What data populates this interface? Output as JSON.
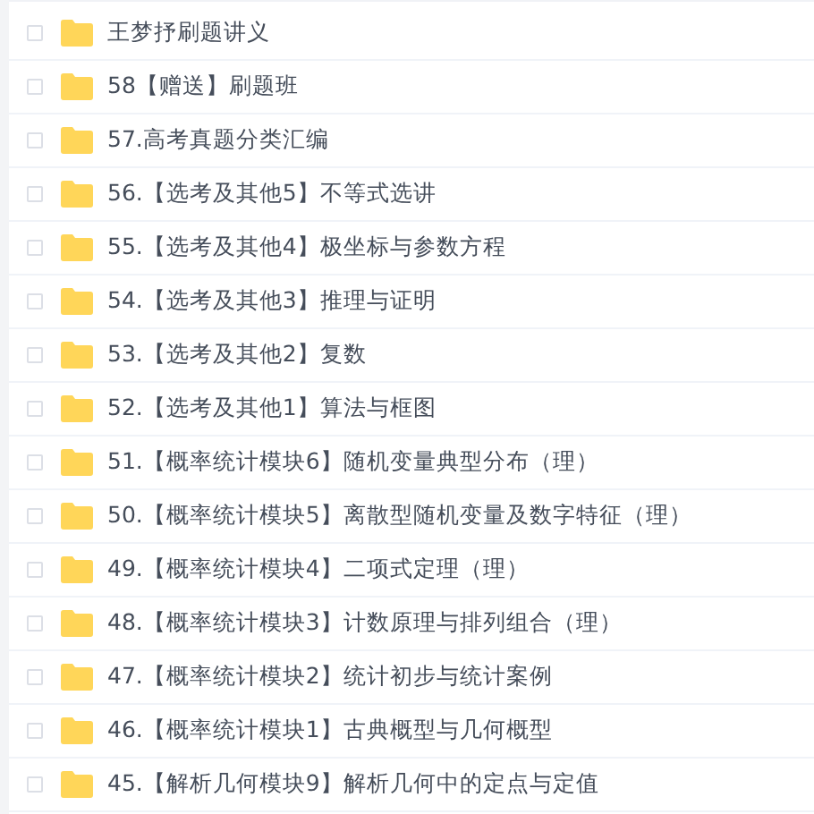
{
  "files": [
    {
      "name": "王梦抒刷题讲义",
      "checked": false
    },
    {
      "name": "58【赠送】刷题班",
      "checked": false
    },
    {
      "name": "57.高考真题分类汇编",
      "checked": false
    },
    {
      "name": "56.【选考及其他5】不等式选讲",
      "checked": false
    },
    {
      "name": "55.【选考及其他4】极坐标与参数方程",
      "checked": false
    },
    {
      "name": "54.【选考及其他3】推理与证明",
      "checked": false
    },
    {
      "name": "53.【选考及其他2】复数",
      "checked": false
    },
    {
      "name": "52.【选考及其他1】算法与框图",
      "checked": false
    },
    {
      "name": "51.【概率统计模块6】随机变量典型分布（理）",
      "checked": false
    },
    {
      "name": "50.【概率统计模块5】离散型随机变量及数字特征（理）",
      "checked": false
    },
    {
      "name": "49.【概率统计模块4】二项式定理（理）",
      "checked": false
    },
    {
      "name": "48.【概率统计模块3】计数原理与排列组合（理）",
      "checked": false
    },
    {
      "name": "47.【概率统计模块2】统计初步与统计案例",
      "checked": false
    },
    {
      "name": "46.【概率统计模块1】古典概型与几何概型",
      "checked": false
    },
    {
      "name": "45.【解析几何模块9】解析几何中的定点与定值",
      "checked": false
    }
  ]
}
